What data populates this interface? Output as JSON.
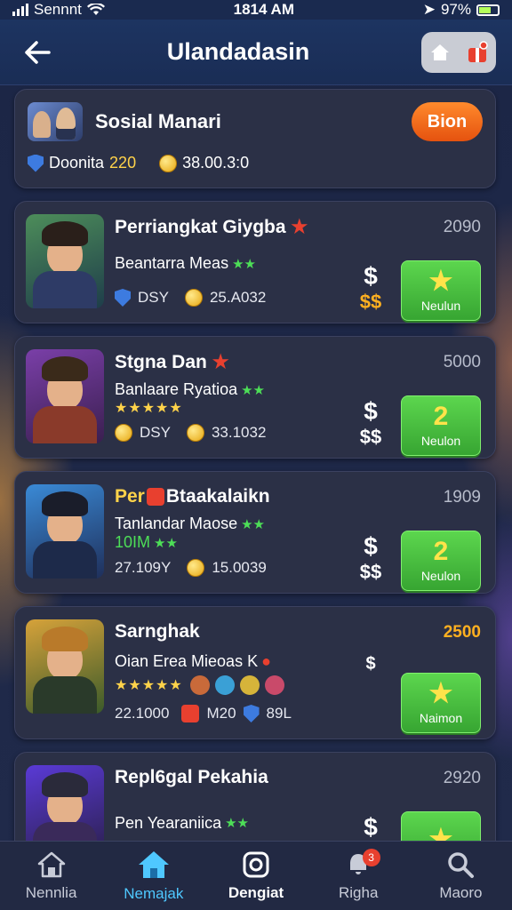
{
  "status_bar": {
    "carrier": "Sennnt",
    "time": "1814 AM",
    "battery": "97%"
  },
  "header": {
    "title": "Ulandadasin"
  },
  "profile": {
    "name": "Sosial Manari",
    "action_label": "Bion",
    "stat1_label": "Doonita",
    "stat1_value": "220",
    "stat2_value": "38.00.3:0"
  },
  "games": [
    {
      "title": "Perriangkat Giygba",
      "subtitle": "Beantarra Meas",
      "meta1": "DSY",
      "meta2": "25.A032",
      "score": "2090",
      "price_main": "$",
      "price_sub": "$$",
      "button_big": "★",
      "button_label": "Neulun"
    },
    {
      "title": "Stgna Dan",
      "subtitle": "Banlaare Ryatioa",
      "rating": "★★★★★",
      "meta1": "DSY",
      "meta2": "33.1032",
      "score": "5000",
      "price_main": "$",
      "price_sub": "$$",
      "button_big": "2",
      "button_label": "Neulon"
    },
    {
      "title_prefix": "Per",
      "title": "Btaakalaikn",
      "subtitle": "Tanlandar Maose",
      "rating": "10IM",
      "meta1": "27.109Y",
      "meta2": "15.0039",
      "score": "1909",
      "price_main": "$",
      "price_sub": "$$",
      "button_big": "2",
      "button_label": "Neulon"
    },
    {
      "title": "Sarnghak",
      "subtitle": "Oian Erea Mieoas K",
      "rating": "★★★★★",
      "meta1": "22.1000",
      "meta2": "M20",
      "meta3": "89L",
      "score": "2500",
      "price_main": "$",
      "button_big": "★",
      "button_label": "Naimon"
    },
    {
      "title": "Repl6gal Pekahia",
      "subtitle": "Pen Yearaniica",
      "score": "2920",
      "price_main": "$",
      "button_big": "★",
      "button_label": ""
    }
  ],
  "nav": [
    {
      "label": "Nennlia",
      "icon": "home-icon"
    },
    {
      "label": "Nemajak",
      "icon": "house-active-icon"
    },
    {
      "label": "Dengiat",
      "icon": "camera-icon"
    },
    {
      "label": "Righa",
      "icon": "bell-icon",
      "badge": "3"
    },
    {
      "label": "Maoro",
      "icon": "search-icon"
    }
  ],
  "colors": {
    "accent_orange": "#e5520f",
    "accent_green": "#4ec443",
    "nav_active": "#4fc8ff",
    "gold": "#ffd34a"
  }
}
